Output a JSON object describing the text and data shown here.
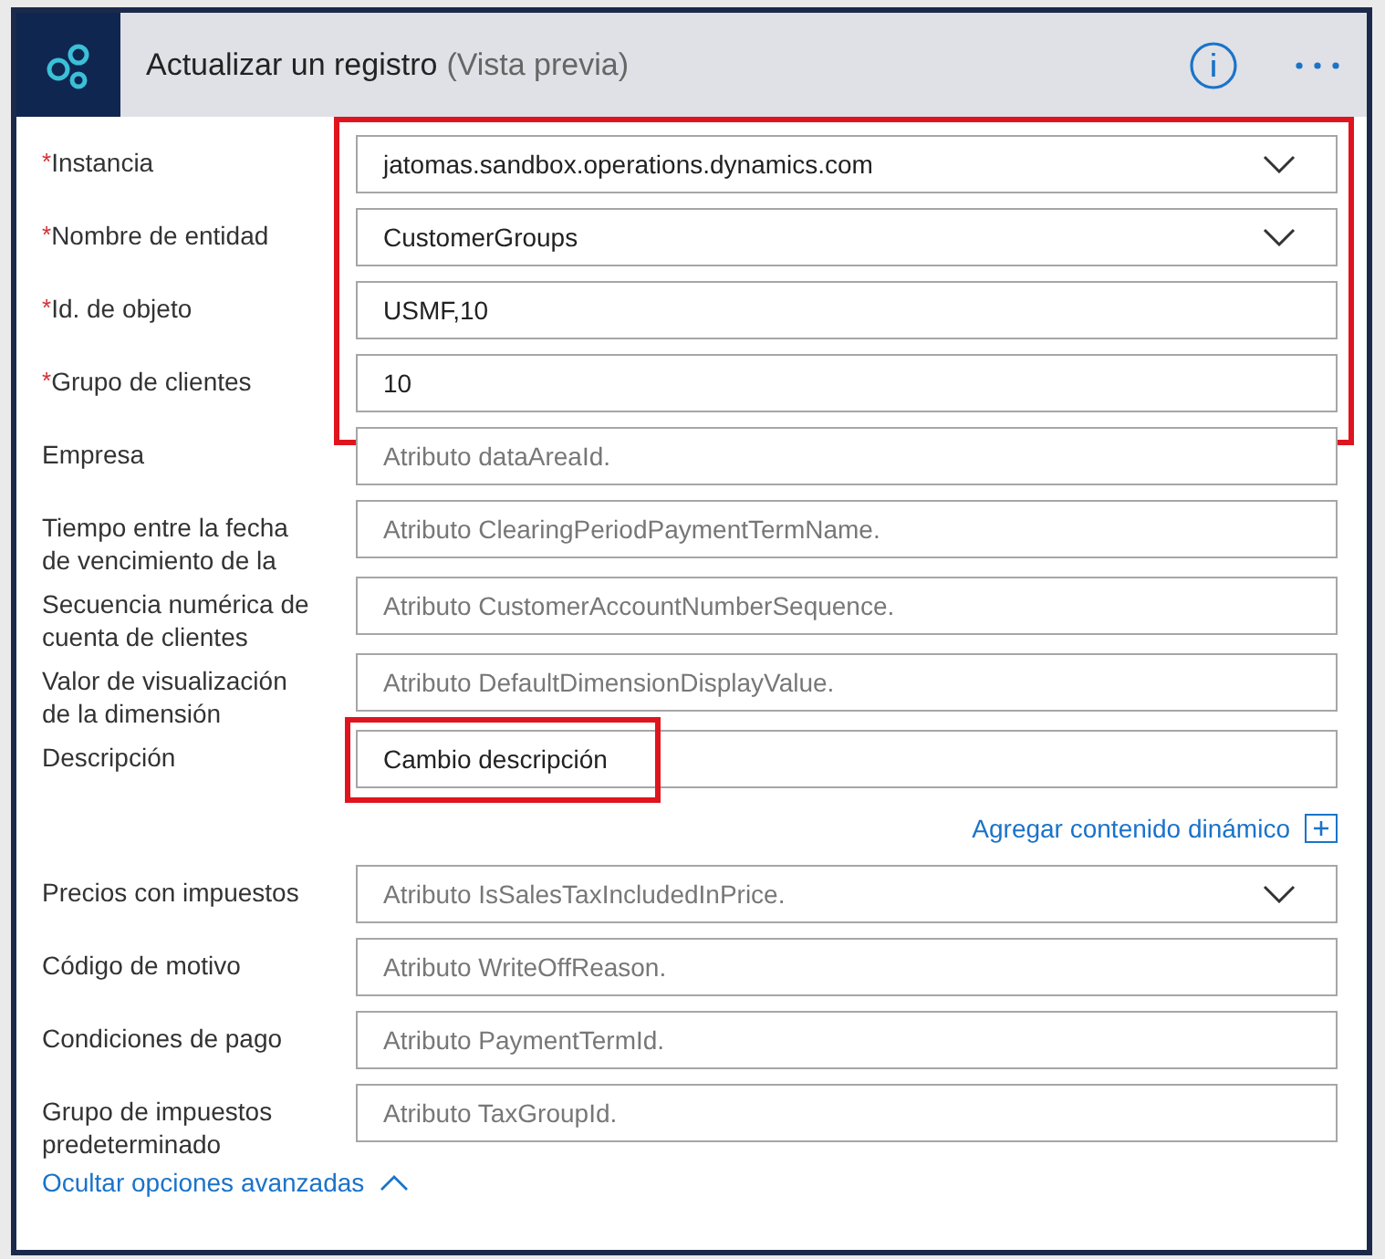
{
  "header": {
    "title": "Actualizar un registro",
    "subtitle": "(Vista previa)"
  },
  "fields": [
    {
      "label": "Instancia",
      "required_mark": "*",
      "kind": "dropdown",
      "value": "jatomas.sandbox.operations.dynamics.com",
      "highlighted": true
    },
    {
      "label": "Nombre de entidad",
      "required_mark": "*",
      "kind": "dropdown",
      "value": "CustomerGroups",
      "highlighted": true
    },
    {
      "label": "Id. de objeto",
      "required_mark": "*",
      "kind": "text",
      "value": "USMF,10",
      "highlighted": true
    },
    {
      "label": "Grupo de clientes",
      "required_mark": "*",
      "kind": "text",
      "value": "10",
      "highlighted": true
    },
    {
      "label": "Empresa",
      "kind": "text",
      "placeholder": "Atributo dataAreaId.",
      "highlighted": false
    },
    {
      "label": "Tiempo entre la fecha de vencimiento de la",
      "kind": "text",
      "placeholder": "Atributo ClearingPeriodPaymentTermName.",
      "highlighted": false
    },
    {
      "label": "Secuencia numérica de cuenta de clientes",
      "kind": "text",
      "placeholder": "Atributo CustomerAccountNumberSequence.",
      "highlighted": false
    },
    {
      "label": "Valor de visualización de la dimensión",
      "kind": "text",
      "placeholder": "Atributo DefaultDimensionDisplayValue.",
      "highlighted": false
    },
    {
      "label": "Descripción",
      "kind": "text",
      "value": "Cambio descripción",
      "highlighted": true,
      "dynamic_link": "Agregar contenido dinámico"
    },
    {
      "label": "Precios con impuestos",
      "kind": "dropdown",
      "placeholder": "Atributo IsSalesTaxIncludedInPrice.",
      "highlighted": false
    },
    {
      "label": "Código de motivo",
      "kind": "text",
      "placeholder": "Atributo WriteOffReason.",
      "highlighted": false
    },
    {
      "label": "Condiciones de pago",
      "kind": "text",
      "placeholder": "Atributo PaymentTermId.",
      "highlighted": false
    },
    {
      "label": "Grupo de impuestos predeterminado",
      "kind": "text",
      "placeholder": "Atributo TaxGroupId.",
      "highlighted": false
    }
  ],
  "advanced_link": "Ocultar opciones avanzadas"
}
